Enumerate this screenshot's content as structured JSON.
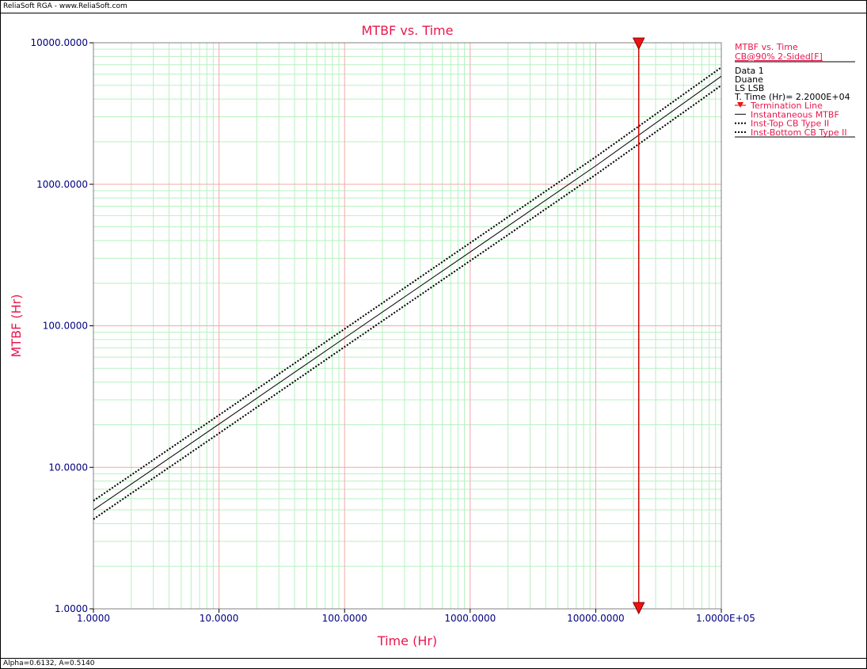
{
  "window": {
    "title": "ReliaSoft RGA - www.ReliaSoft.com",
    "status": "Alpha=0.6132, A=0.5140"
  },
  "colors": {
    "accent": "#e8174d",
    "axis_text": "#000080",
    "major_grid": "#f3a8a8",
    "minor_grid": "#b8f0c0",
    "termination": "#cc0000",
    "series": "#000000"
  },
  "legend": {
    "line1": "MTBF vs. Time",
    "line2": "CB@90% 2-Sided[F]",
    "info": [
      "Data 1",
      "Duane",
      "LS LSB",
      "T. Time (Hr)= 2.2000E+04"
    ],
    "entries": [
      "Termination Line",
      "Instantaneous MTBF",
      "Inst-Top CB Type II",
      "Inst-Bottom CB Type II"
    ]
  },
  "chart_data": {
    "type": "line",
    "title": "MTBF vs. Time",
    "xlabel": "Time (Hr)",
    "ylabel": "MTBF (Hr)",
    "x_scale": "log",
    "y_scale": "log",
    "xlim": [
      1,
      100000
    ],
    "ylim": [
      1,
      10000
    ],
    "x_tick_labels": [
      "1.0000",
      "10.0000",
      "100.0000",
      "1000.0000",
      "10000.0000",
      "1.0000E+05"
    ],
    "y_tick_labels": [
      "1.0000",
      "10.0000",
      "100.0000",
      "1000.0000",
      "10000.0000"
    ],
    "grid": true,
    "legend_position": "right",
    "termination_time": 22000,
    "series": [
      {
        "name": "Instantaneous MTBF",
        "style": "solid",
        "x": [
          1,
          10,
          100,
          1000,
          10000,
          100000
        ],
        "y": [
          5,
          20.2,
          82,
          332,
          1350,
          5800
        ]
      },
      {
        "name": "Inst-Top CB Type II",
        "style": "dotted",
        "x": [
          1,
          10,
          100,
          1000,
          10000,
          100000
        ],
        "y": [
          5.8,
          23.4,
          95,
          385,
          1560,
          6700
        ]
      },
      {
        "name": "Inst-Bottom CB Type II",
        "style": "dotted",
        "x": [
          1,
          10,
          100,
          1000,
          10000,
          100000
        ],
        "y": [
          4.3,
          17.4,
          71,
          288,
          1170,
          5000
        ]
      }
    ]
  }
}
